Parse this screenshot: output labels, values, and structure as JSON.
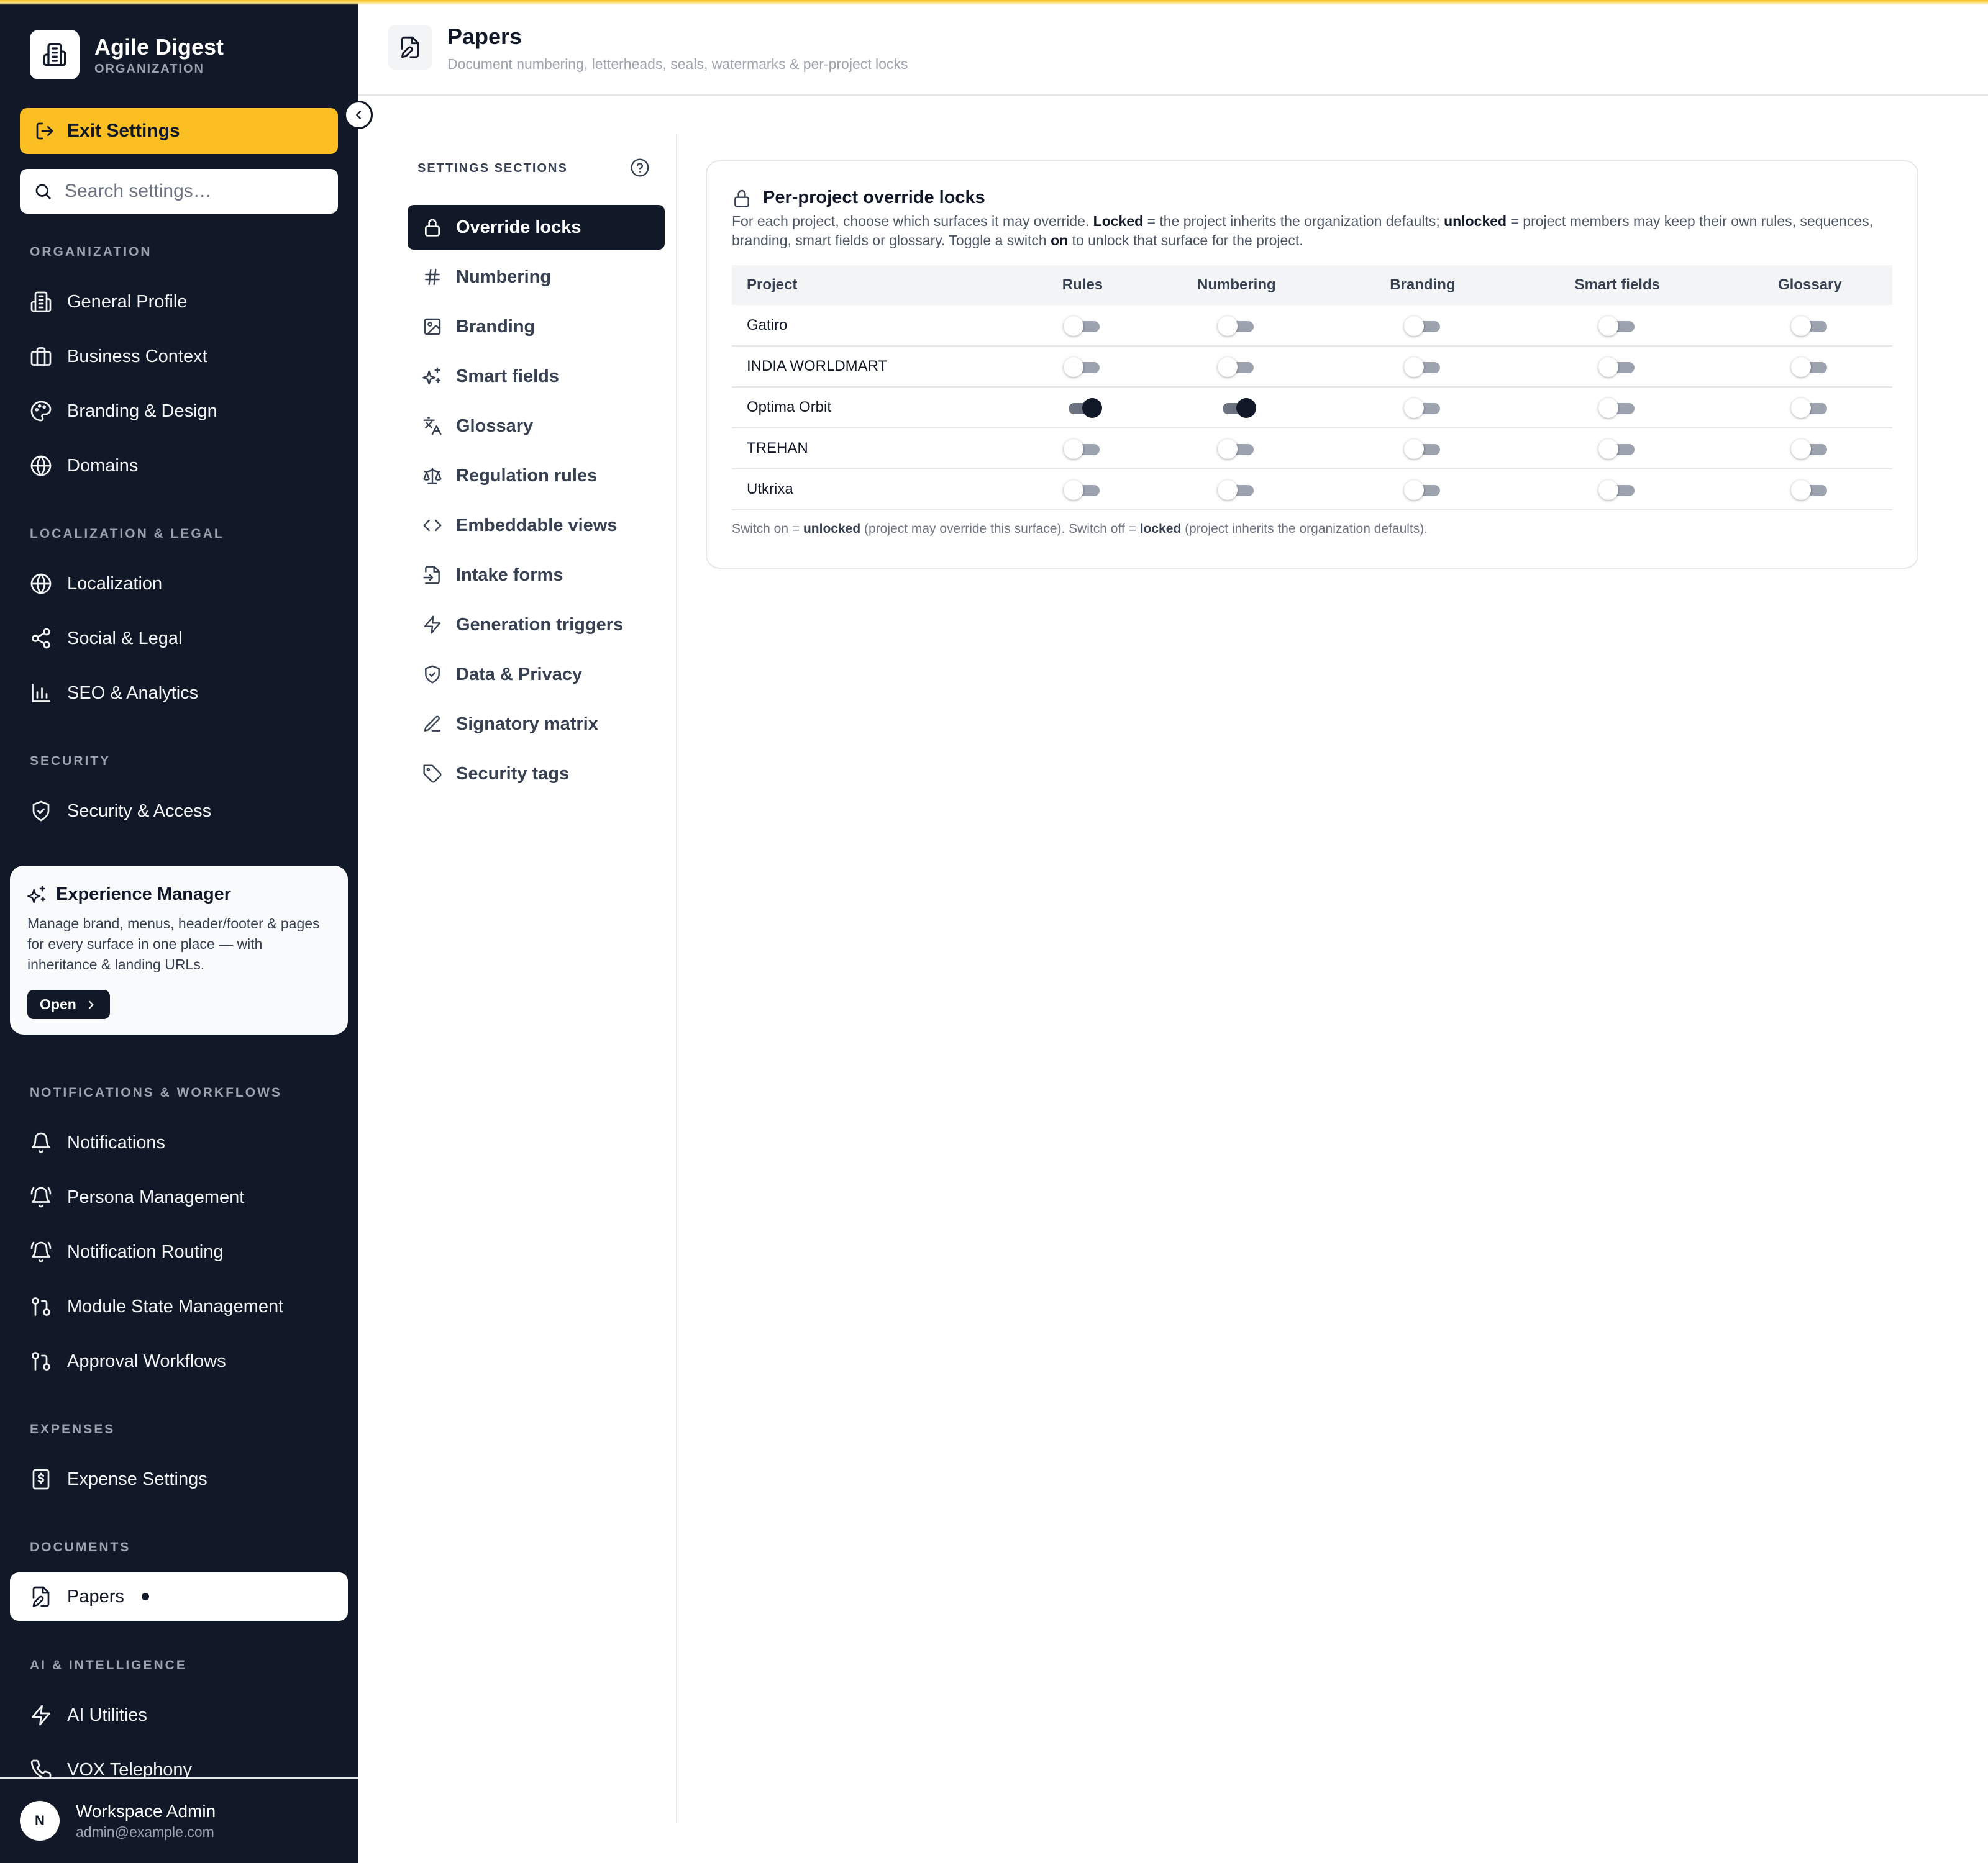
{
  "app": {
    "org_name": "Agile Digest",
    "org_type": "ORGANIZATION",
    "exit_label": "Exit Settings",
    "search_placeholder": "Search settings…"
  },
  "sidebar": {
    "sections": [
      {
        "label": "ORGANIZATION",
        "items": [
          {
            "label": "General Profile",
            "icon": "building-icon"
          },
          {
            "label": "Business Context",
            "icon": "briefcase-icon"
          },
          {
            "label": "Branding & Design",
            "icon": "palette-icon"
          },
          {
            "label": "Domains",
            "icon": "globe-icon"
          }
        ]
      },
      {
        "label": "LOCALIZATION & LEGAL",
        "items": [
          {
            "label": "Localization",
            "icon": "globe-icon"
          },
          {
            "label": "Social & Legal",
            "icon": "share-icon"
          },
          {
            "label": "SEO & Analytics",
            "icon": "bar-chart-icon"
          }
        ]
      },
      {
        "label": "SECURITY",
        "items": [
          {
            "label": "Security & Access",
            "icon": "shield-icon"
          }
        ]
      },
      {
        "label": "NOTIFICATIONS & WORKFLOWS",
        "items": [
          {
            "label": "Notifications",
            "icon": "bell-icon"
          },
          {
            "label": "Persona Management",
            "icon": "bell-ring-icon"
          },
          {
            "label": "Notification Routing",
            "icon": "bell-ring-icon"
          },
          {
            "label": "Module State Management",
            "icon": "git-pull-request-icon"
          },
          {
            "label": "Approval Workflows",
            "icon": "git-pull-request-icon"
          }
        ]
      },
      {
        "label": "EXPENSES",
        "items": [
          {
            "label": "Expense Settings",
            "icon": "receipt-icon"
          }
        ]
      },
      {
        "label": "DOCUMENTS",
        "items": [
          {
            "label": "Papers",
            "icon": "file-edit-icon"
          }
        ]
      },
      {
        "label": "AI & INTELLIGENCE",
        "items": [
          {
            "label": "AI Utilities",
            "icon": "zap-icon"
          },
          {
            "label": "VOX Telephony",
            "icon": "phone-icon"
          }
        ]
      }
    ],
    "experience_manager": {
      "title": "Experience Manager",
      "description": "Manage brand, menus, header/footer & pages for every surface in one place — with inheritance & landing URLs.",
      "open_label": "Open"
    },
    "user": {
      "initial": "N",
      "name": "Workspace Admin",
      "email": "admin@example.com"
    }
  },
  "header": {
    "title": "Papers",
    "subtitle": "Document numbering, letterheads, seals, watermarks & per-project locks"
  },
  "settings_sections": {
    "heading": "SETTINGS SECTIONS",
    "active": "Override locks",
    "items": [
      {
        "label": "Override locks",
        "icon": "lock-icon"
      },
      {
        "label": "Numbering",
        "icon": "hash-icon"
      },
      {
        "label": "Branding",
        "icon": "image-icon"
      },
      {
        "label": "Smart fields",
        "icon": "sparkles-icon"
      },
      {
        "label": "Glossary",
        "icon": "languages-icon"
      },
      {
        "label": "Regulation rules",
        "icon": "scale-icon"
      },
      {
        "label": "Embeddable views",
        "icon": "code-icon"
      },
      {
        "label": "Intake forms",
        "icon": "file-input-icon"
      },
      {
        "label": "Generation triggers",
        "icon": "zap-icon"
      },
      {
        "label": "Data & Privacy",
        "icon": "shield-check-icon"
      },
      {
        "label": "Signatory matrix",
        "icon": "pen-icon"
      },
      {
        "label": "Security tags",
        "icon": "tag-icon"
      }
    ]
  },
  "locks_panel": {
    "title": "Per-project override locks",
    "description": {
      "p1": "For each project, choose which surfaces it may override. ",
      "locked": "Locked",
      "p2": " = the project inherits the organization defaults; ",
      "unlocked": "unlocked",
      "p3": " = project members may keep their own rules, sequences, branding, smart fields or glossary. Toggle a switch ",
      "on": "on",
      "p4": " to unlock that surface for the project."
    },
    "columns": [
      "Project",
      "Rules",
      "Numbering",
      "Branding",
      "Smart fields",
      "Glossary"
    ],
    "rows": [
      {
        "project": "Gatiro",
        "values": [
          false,
          false,
          false,
          false,
          false
        ]
      },
      {
        "project": "INDIA WORLDMART",
        "values": [
          false,
          false,
          false,
          false,
          false
        ]
      },
      {
        "project": "Optima Orbit",
        "values": [
          true,
          true,
          false,
          false,
          false
        ]
      },
      {
        "project": "TREHAN",
        "values": [
          false,
          false,
          false,
          false,
          false
        ]
      },
      {
        "project": "Utkrixa",
        "values": [
          false,
          false,
          false,
          false,
          false
        ]
      }
    ],
    "footnote": {
      "p1": "Switch on = ",
      "unlocked": "unlocked",
      "p2": " (project may override this surface). Switch off = ",
      "locked": "locked",
      "p3": " (project inherits the organization defaults)."
    }
  },
  "colors": {
    "sidebar_bg": "#111827",
    "accent": "#fbbf24",
    "active_section": "#111827"
  }
}
